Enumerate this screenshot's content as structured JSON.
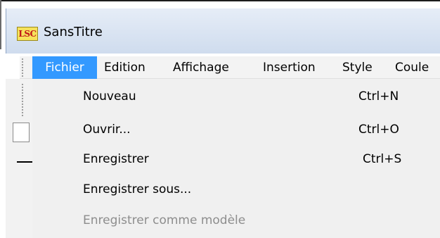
{
  "window": {
    "title": "SansTitre",
    "logo_text": "LSC"
  },
  "menubar": {
    "items": [
      {
        "label": "Fichier",
        "active": true
      },
      {
        "label": "Edition"
      },
      {
        "label": "Affichage"
      },
      {
        "label": "Insertion"
      },
      {
        "label": "Style"
      },
      {
        "label": "Coule"
      }
    ]
  },
  "file_menu": {
    "items": [
      {
        "label": "Nouveau",
        "shortcut": "Ctrl+N"
      },
      {
        "label": "Ouvrir...",
        "shortcut": "Ctrl+O"
      },
      {
        "label": "Enregistrer",
        "shortcut": "Ctrl+S"
      },
      {
        "label": "Enregistrer sous...",
        "shortcut": ""
      },
      {
        "label": "Enregistrer comme modèle",
        "shortcut": "",
        "disabled": true
      }
    ]
  },
  "colors": {
    "highlight": "#3399ff",
    "disabled_text": "#8d8d8d",
    "menu_bg": "#f0f0f0"
  }
}
